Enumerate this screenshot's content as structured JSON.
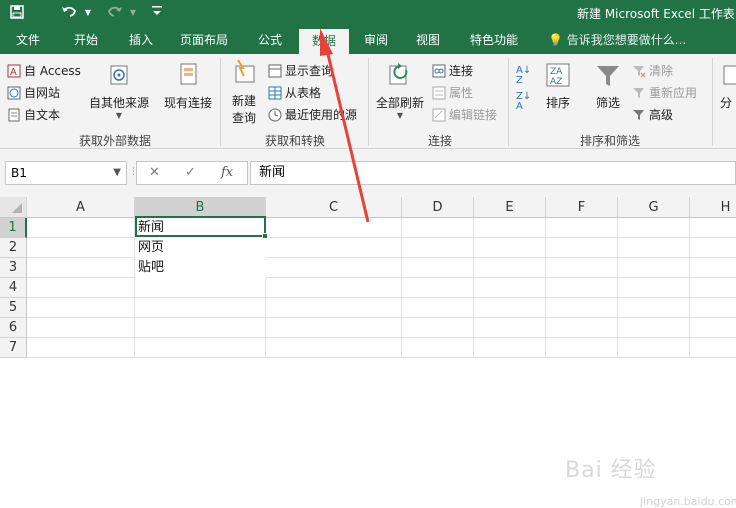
{
  "titlebar": {
    "title": "新建 Microsoft Excel 工作表..."
  },
  "tabs": [
    {
      "label": "文件",
      "active": false
    },
    {
      "label": "开始",
      "active": false
    },
    {
      "label": "插入",
      "active": false
    },
    {
      "label": "页面布局",
      "active": false
    },
    {
      "label": "公式",
      "active": false
    },
    {
      "label": "数据",
      "active": true
    },
    {
      "label": "审阅",
      "active": false
    },
    {
      "label": "视图",
      "active": false
    },
    {
      "label": "特色功能",
      "active": false
    }
  ],
  "tell_me": "告诉我您想要做什么...",
  "ribbon": {
    "get_external": {
      "from_access": "自 Access",
      "from_web": "自网站",
      "from_text": "自文本",
      "from_other": "自其他来源",
      "existing_connections": "现有连接",
      "group": "获取外部数据"
    },
    "get_transform": {
      "new_query": "新建",
      "new_query2": "查询",
      "show_queries": "显示查询",
      "from_table": "从表格",
      "recent_sources": "最近使用的源",
      "group": "获取和转换"
    },
    "connections": {
      "refresh_all": "全部刷新",
      "connections": "连接",
      "properties": "属性",
      "edit_links": "编辑链接",
      "group": "连接"
    },
    "sort_filter": {
      "sort": "排序",
      "filter": "筛选",
      "clear": "清除",
      "reapply": "重新应用",
      "advanced": "高级",
      "group": "排序和筛选"
    },
    "split": "分"
  },
  "formula": {
    "namebox": "B1",
    "value": "新闻"
  },
  "grid": {
    "columns": [
      "A",
      "B",
      "C",
      "D",
      "E",
      "F",
      "G",
      "H"
    ],
    "rows": [
      "1",
      "2",
      "3",
      "4",
      "5",
      "6",
      "7"
    ],
    "cells": {
      "B1": "新闻",
      "B2": "网页",
      "B3": "贴吧"
    }
  },
  "colors": {
    "excel_green": "#217346",
    "arrow": "#e8413a"
  },
  "watermark": {
    "brand": "Bai 经验",
    "sub": "jingyan.baidu.com"
  }
}
